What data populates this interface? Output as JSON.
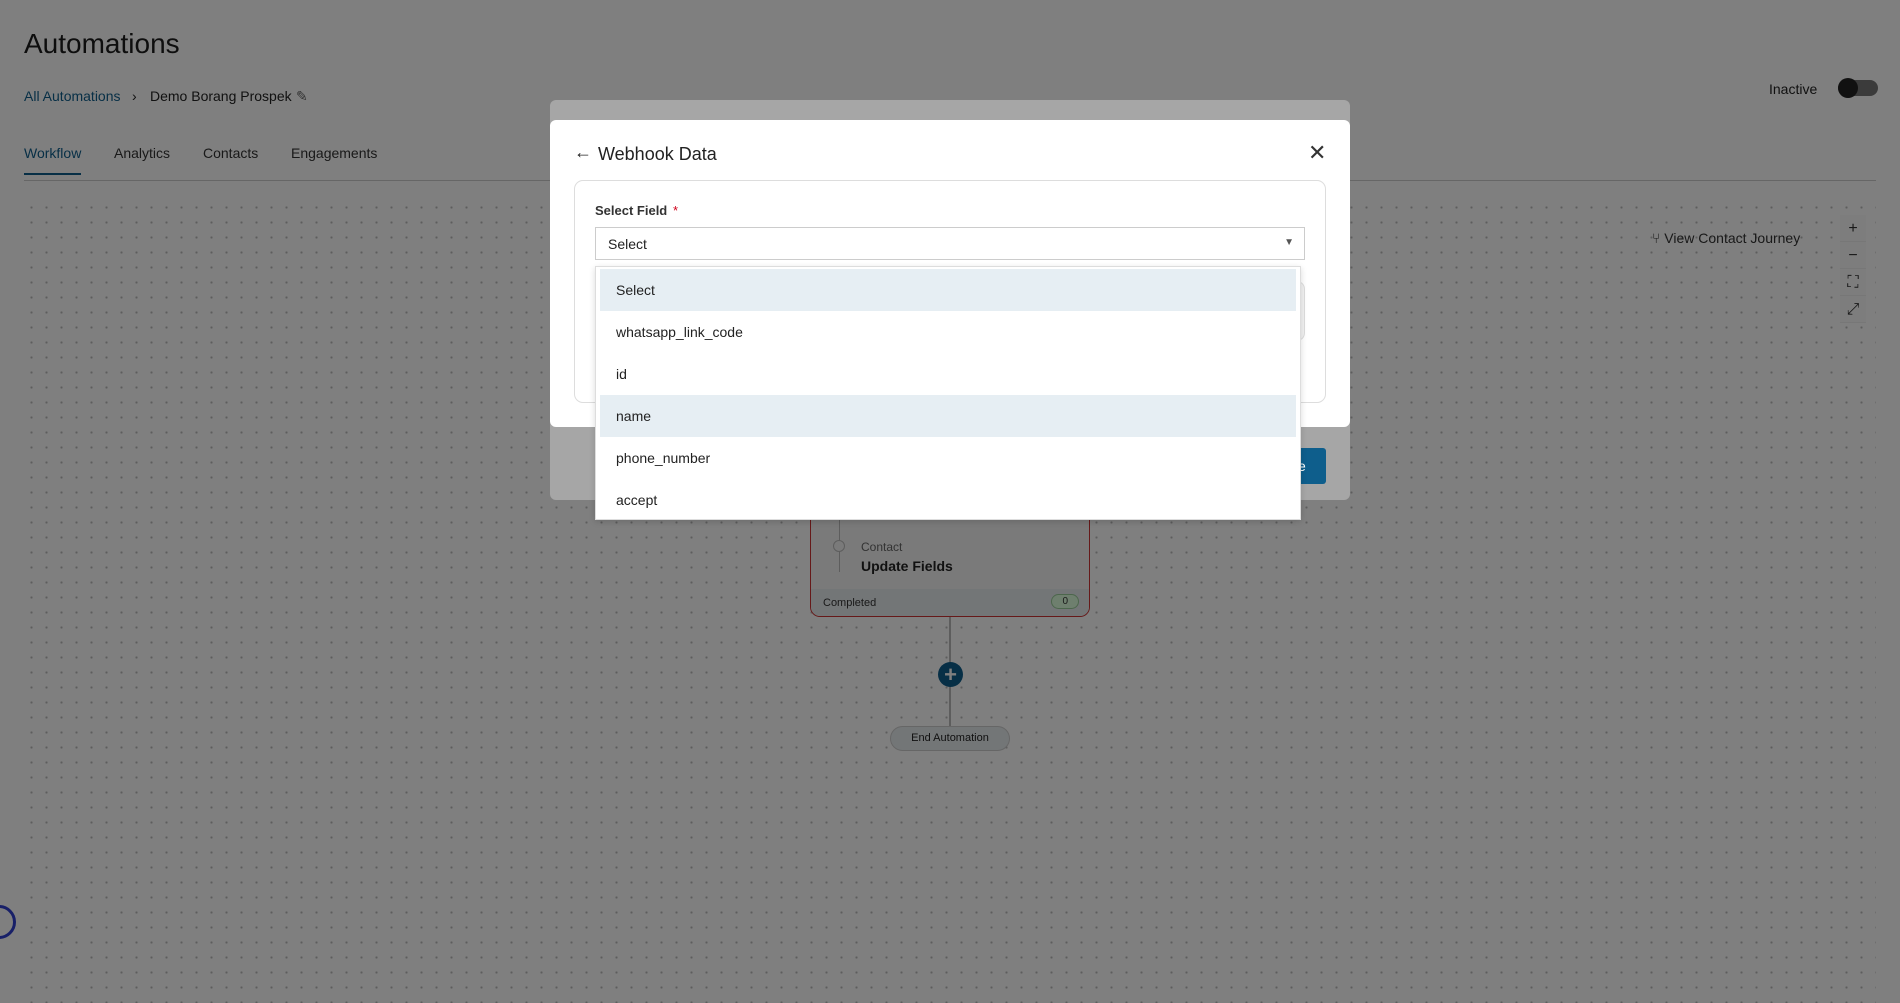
{
  "page": {
    "title": "Automations"
  },
  "breadcrumb": {
    "root": "All Automations",
    "current": "Demo Borang Prospek"
  },
  "status": {
    "label": "Inactive",
    "active": false
  },
  "tabs": [
    {
      "label": "Workflow",
      "active": true
    },
    {
      "label": "Analytics"
    },
    {
      "label": "Contacts"
    },
    {
      "label": "Engagements"
    }
  ],
  "canvas": {
    "view_journey": "View Contact Journey",
    "node": {
      "category": "Contact",
      "title": "Update Fields",
      "footer": "Completed",
      "count": "0"
    },
    "end": "End Automation"
  },
  "modal": {
    "title": "Webhook Data",
    "field_label": "Select Field",
    "required_mark": "*",
    "select_value": "Select",
    "options": [
      "Select",
      "whatsapp_link_code",
      "id",
      "name",
      "phone_number",
      "accept"
    ],
    "highlighted": [
      "Select",
      "name"
    ],
    "save_partial": "e"
  },
  "colors": {
    "accent": "#0e5e8c",
    "required": "#d0021b",
    "highlight": "#e6eef3"
  }
}
